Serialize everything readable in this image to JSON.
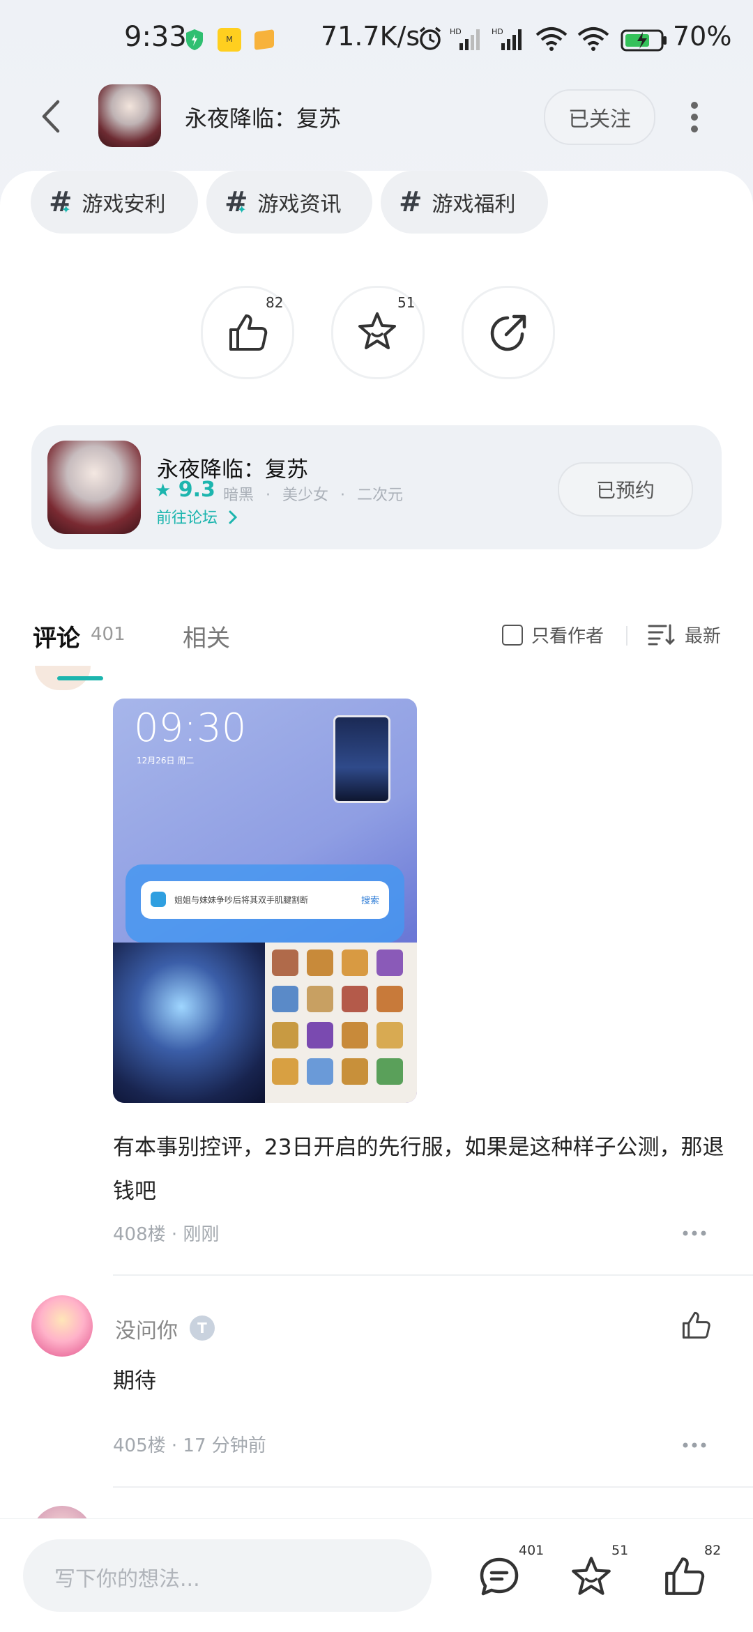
{
  "status_bar": {
    "time": "9:33",
    "net_speed": "71.7K/s",
    "battery": "70%"
  },
  "header": {
    "title": "永夜降临：复苏",
    "follow_label": "已关注"
  },
  "tags": [
    {
      "label": "游戏安利"
    },
    {
      "label": "游戏资讯"
    },
    {
      "label": "游戏福利"
    }
  ],
  "actions": {
    "like_count": "82",
    "fav_count": "51"
  },
  "game_card": {
    "name": "永夜降临：复苏",
    "score": "9.3",
    "tags": [
      "暗黑",
      "美少女",
      "二次元"
    ],
    "forum_link": "前往论坛",
    "reserve_label": "已预约"
  },
  "tabs": {
    "comment_label": "评论",
    "comment_count": "401",
    "related_label": "相关",
    "only_author": "只看作者",
    "sort_label": "最新"
  },
  "comment1": {
    "image": {
      "clock": "09:30",
      "date": "12月26日 周二",
      "search_query": "姐姐与妹妹争吵后将其双手肌腱割断",
      "search_button": "搜索"
    },
    "text": "有本事别控评，23日开启的先行服，如果是这种样子公测，那退钱吧",
    "meta": "408楼 · 刚刚",
    "more": "..."
  },
  "comment2": {
    "username": "没问你",
    "level": "T",
    "text": "期待",
    "meta": "405楼 · 17 分钟前",
    "more": "..."
  },
  "bottom_bar": {
    "placeholder": "写下你的想法...",
    "comment_count": "401",
    "fav_count": "51",
    "like_count": "82"
  },
  "colors": {
    "accent": "#1cb5ae",
    "background": "#eef1f6"
  }
}
